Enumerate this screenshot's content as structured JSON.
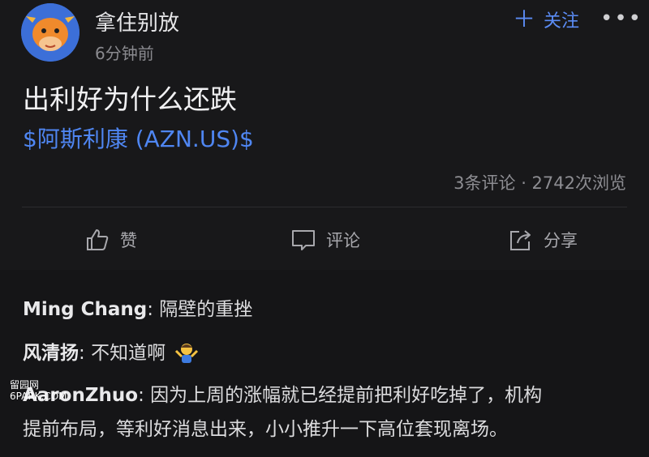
{
  "post": {
    "username": "拿住别放",
    "time": "6分钟前",
    "follow_label": "关注",
    "title": "出利好为什么还跌",
    "ticker": "$阿斯利康 (AZN.US)$",
    "stats": "3条评论 · 2742次浏览",
    "actions": {
      "like": "赞",
      "comment": "评论",
      "share": "分享"
    }
  },
  "comments": [
    {
      "author": "Ming Chang",
      "text": "隔壁的重挫"
    },
    {
      "author": "风清扬",
      "text": "不知道啊"
    },
    {
      "author": "AaronZhuo",
      "text": "因为上周的涨幅就已经提前把利好吃掉了，机构",
      "text2": "提前布局，等利好消息出来，小小推升一下高位套现离场。"
    }
  ],
  "watermark": {
    "line1": "留园网",
    "line2": "6PARK.COM"
  },
  "colors": {
    "accent": "#4f86f2",
    "background": "#18181a"
  }
}
